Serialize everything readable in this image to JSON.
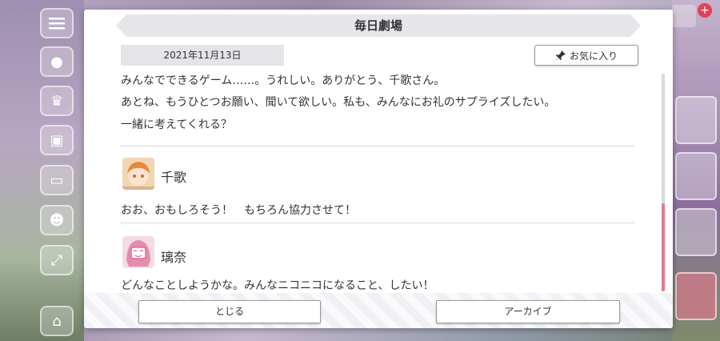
{
  "dialog": {
    "title": "毎日劇場",
    "date": "2021年11月13日",
    "favorite_label": "お気に入り",
    "messages_top": [
      "みんなでできるゲーム……。うれしい。ありがとう、千歌さん。",
      "あとね、もうひとつお願い、聞いて欲しい。私も、みんなにお礼のサプライズしたい。",
      "一緒に考えてくれる？"
    ],
    "speakers": [
      {
        "name": "千歌",
        "line": "おお、おもしろそう！　もちろん協力させて！"
      },
      {
        "name": "璃奈",
        "line": "どんなことしようかな。みんなニコニコになること、したい！"
      }
    ],
    "close_label": "とじる",
    "archive_label": "アーカイブ"
  },
  "colors": {
    "accent_scroll": "#e07b8c",
    "header_bg": "#e6e6ea"
  },
  "icons": {
    "favorite": "pin-icon",
    "menu": "hamburger-icon"
  }
}
